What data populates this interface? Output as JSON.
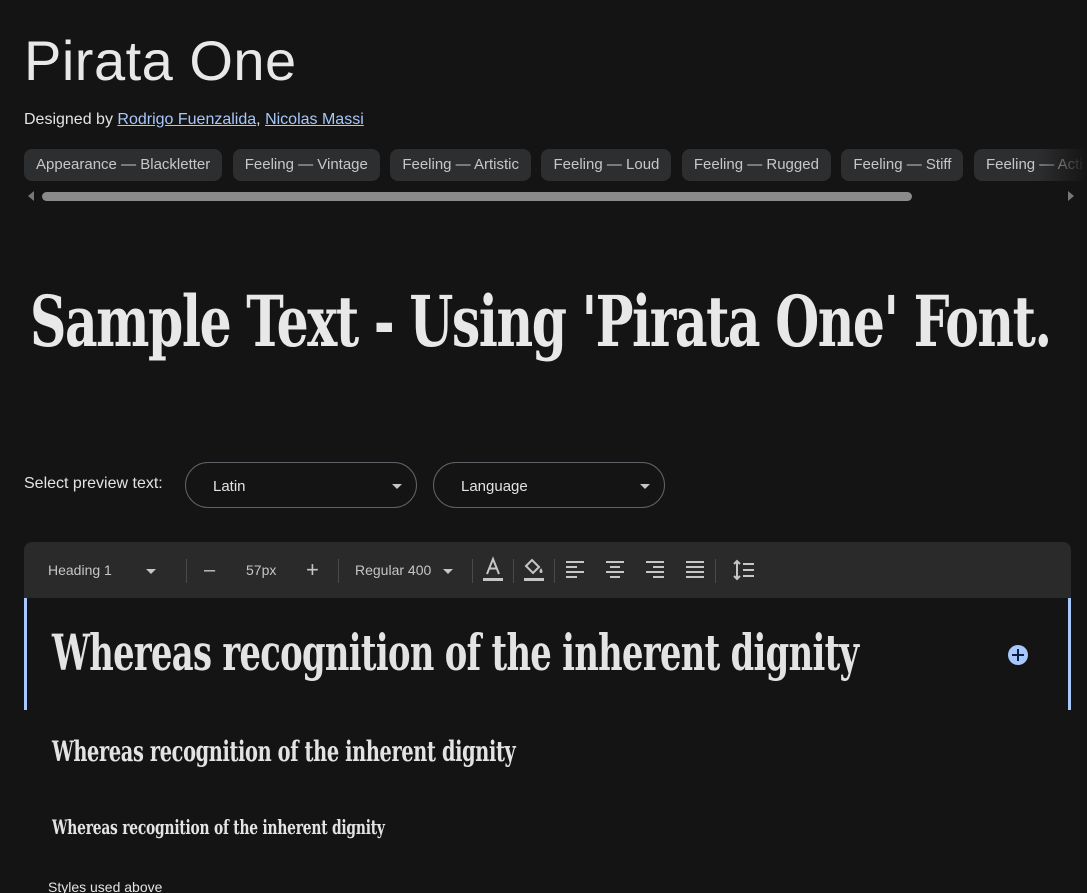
{
  "font": {
    "name": "Pirata One",
    "designed_by_prefix": "Designed by",
    "designers": [
      "Rodrigo Fuenzalida",
      "Nicolas Massi"
    ],
    "designer_separator": ","
  },
  "tags": [
    "Appearance — Blackletter",
    "Feeling — Vintage",
    "Feeling — Artistic",
    "Feeling — Loud",
    "Feeling — Rugged",
    "Feeling — Stiff",
    "Feeling — Acti"
  ],
  "sample_text": "Sample Text - Using 'Pirata One' Font.",
  "preview": {
    "label": "Select preview text:",
    "script_select": "Latin",
    "language_select": "Language"
  },
  "toolbar": {
    "style_select": "Heading 1",
    "decrease": "–",
    "size": "57px",
    "increase": "+",
    "weight_select": "Regular 400"
  },
  "preview_lines": [
    "Whereas recognition of the inherent dignity",
    "Whereas recognition of the inherent dignity",
    "Whereas recognition of the inherent dignity"
  ],
  "styles_used_label": "Styles used above",
  "colors": {
    "background": "#141414",
    "link": "#a8c7fa",
    "chip": "#2d2e30",
    "toolbar": "#2a2a2a",
    "accent": "#a8c7fa"
  }
}
